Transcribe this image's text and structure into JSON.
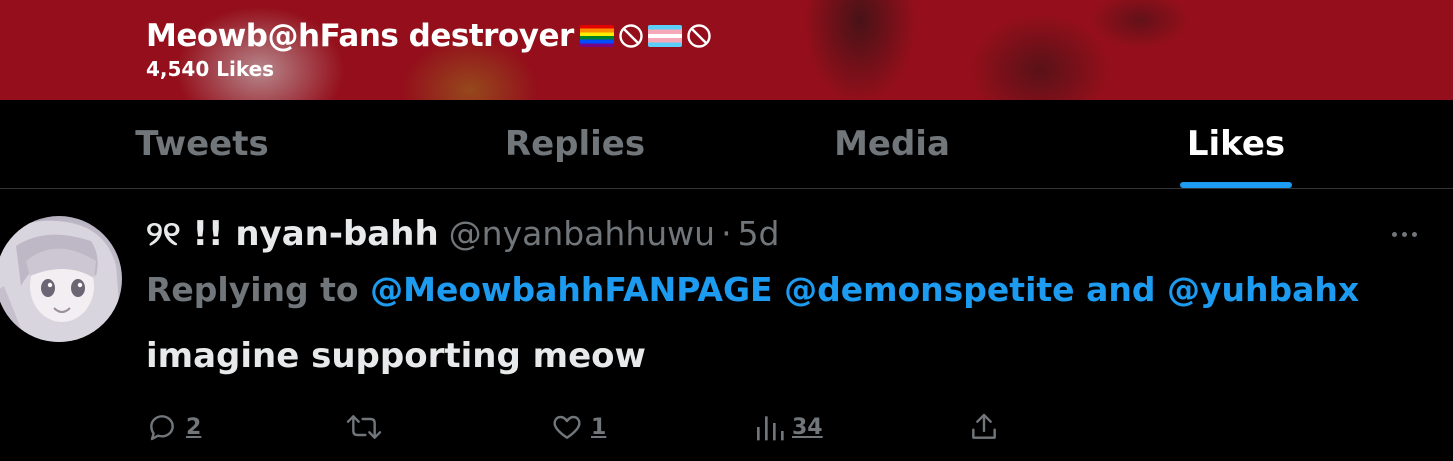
{
  "profile_header": {
    "display_name": "Meowb@hFans destroyer",
    "flags": [
      "rainbow-pride-flag",
      "prohibited-icon",
      "transgender-flag",
      "prohibited-icon"
    ],
    "likes_count_label": "4,540 Likes",
    "background_color": "#940f1b"
  },
  "tabs": [
    {
      "label": "Tweets",
      "active": false
    },
    {
      "label": "Replies",
      "active": false
    },
    {
      "label": "Media",
      "active": false
    },
    {
      "label": "Likes",
      "active": true
    }
  ],
  "tweet": {
    "display_name": "୨୧ !! nyan-bahh",
    "handle": "@nyanbahhuwu",
    "separator": "·",
    "time": "5d",
    "replying_prefix": "Replying to",
    "mention_1": "@MeowbahhFANPAGE",
    "mention_2": "@demonspetite",
    "conjunction": "and",
    "mention_3": "@yuhbahx",
    "text": "imagine supporting meow",
    "reply_count": "2",
    "retweet_count": "",
    "like_count": "1",
    "view_count": "34"
  },
  "colors": {
    "accent": "#1d9bf0",
    "muted": "#71767b",
    "text": "#e7e9ea",
    "background": "#000000"
  }
}
